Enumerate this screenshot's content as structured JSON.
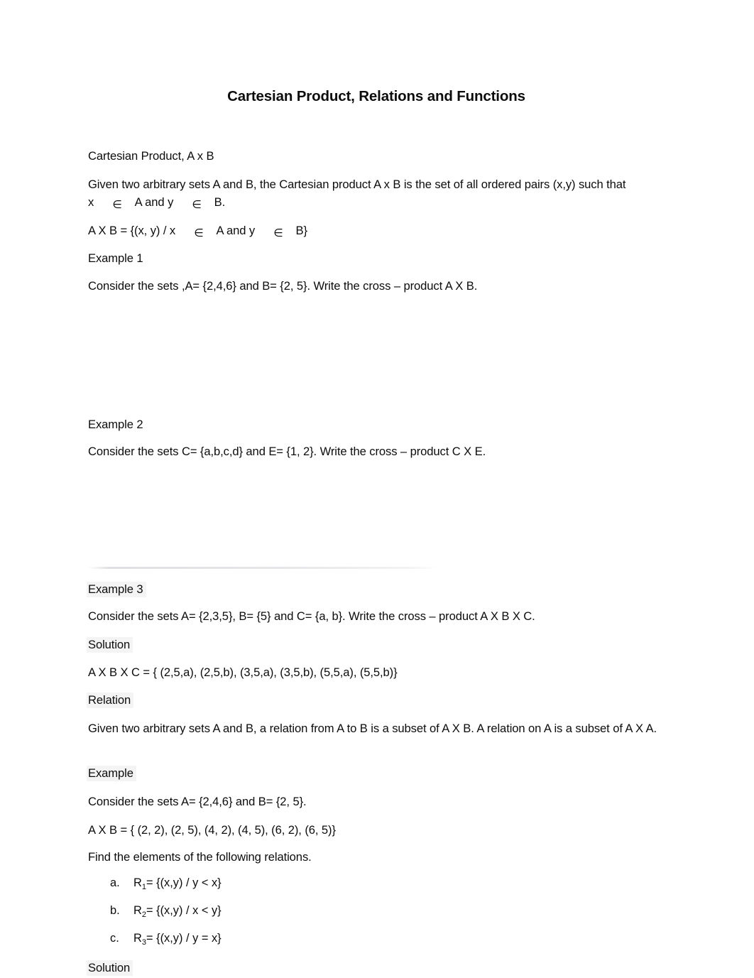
{
  "document": {
    "title": "Cartesian Product, Relations and Functions",
    "page_background": "#ffffff",
    "text_color": "#0d0d0d",
    "highlight_color": "#f4f4f4"
  },
  "sections": {
    "cartesian_heading": "Cartesian Product, A x B",
    "definition_line1": "Given two arbitrary sets A and B, the Cartesian product A x B is the set of all ordered pairs (x,y) such that",
    "definition_line2_a": "x",
    "definition_line2_b": "A and y",
    "definition_line2_c": "B.",
    "member_symbol": "∈",
    "setbuilder_a": "A X B = {(x, y) / x",
    "setbuilder_b": "A and y",
    "setbuilder_c": "B}"
  },
  "examples": [
    {
      "label": "Example 1",
      "prompt": "Consider the sets ,A= {2,4,6} and B= {2, 5}. Write the cross – product A X B."
    },
    {
      "label": "Example 2",
      "prompt": "Consider the sets C= {a,b,c,d} and E= {1, 2}. Write the cross – product C X E."
    },
    {
      "label": "Example 3",
      "prompt": "Consider the sets A= {2,3,5}, B= {5} and C= {a, b}. Write the cross – product A X B X C.",
      "solution_label": "Solution",
      "solution_body": "A X B X C = { (2,5,a), (2,5,b), (3,5,a), (3,5,b), (5,5,a), (5,5,b)}"
    }
  ],
  "relation": {
    "heading": "Relation",
    "definition": "Given two arbitrary sets A and B, a relation from A to B is a subset of A X B. A relation on A is a subset of A X A.",
    "example_label": "Example",
    "example_sets": "Consider the sets A= {2,4,6} and B= {2, 5}.",
    "example_product": " A X B = { (2, 2), (2, 5), (4, 2), (4, 5), (6, 2), (6, 5)}",
    "instruction": "Find the elements of the following relations.",
    "items": [
      {
        "marker": "a.",
        "name": "R",
        "sub": "1",
        "body": "= {(x,y) / y < x}"
      },
      {
        "marker": "b.",
        "name": "R",
        "sub": "2",
        "body": "= {(x,y) / x < y}"
      },
      {
        "marker": "c.",
        "name": "R",
        "sub": "3",
        "body": "= {(x,y) / y = x}"
      }
    ],
    "solution_label": "Solution"
  }
}
